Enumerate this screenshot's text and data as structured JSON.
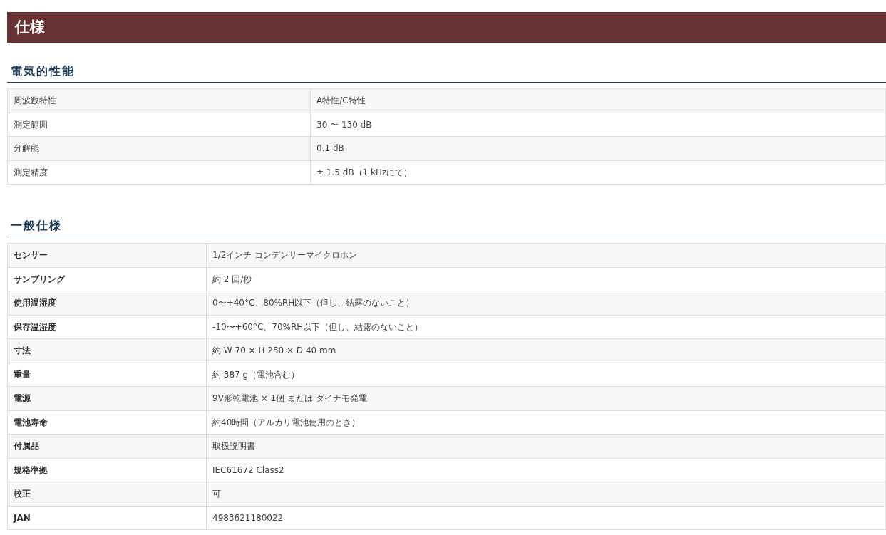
{
  "title": "仕様",
  "sections": [
    {
      "heading": "電気的性能",
      "labels_bold": false,
      "rows": [
        {
          "label": "周波数特性",
          "value": "A特性/C特性"
        },
        {
          "label": "測定範囲",
          "value": "30 〜 130 dB"
        },
        {
          "label": "分解能",
          "value": "0.1 dB"
        },
        {
          "label": "測定精度",
          "value": "± 1.5 dB（1 kHzにて）"
        }
      ]
    },
    {
      "heading": "一般仕様",
      "labels_bold": true,
      "rows": [
        {
          "label": "センサー",
          "value": "1/2インチ コンデンサーマイクロホン"
        },
        {
          "label": "サンプリング",
          "value": "約 2 回/秒"
        },
        {
          "label": "使用温湿度",
          "value": "0〜+40°C、80%RH以下（但し、結露のないこと）"
        },
        {
          "label": "保存温湿度",
          "value": "-10〜+60°C、70%RH以下（但し、結露のないこと）"
        },
        {
          "label": "寸法",
          "value": "約 W 70 × H 250 × D 40 mm"
        },
        {
          "label": "重量",
          "value": "約 387 g（電池含む）"
        },
        {
          "label": "電源",
          "value": "9V形乾電池 × 1個 または ダイナモ発電"
        },
        {
          "label": "電池寿命",
          "value": "約40時間（アルカリ電池使用のとき）"
        },
        {
          "label": "付属品",
          "value": "取扱説明書"
        },
        {
          "label": "規格準拠",
          "value": "IEC61672 Class2"
        },
        {
          "label": "校正",
          "value": "可"
        },
        {
          "label": "JAN",
          "value": "4983621180022"
        }
      ]
    }
  ]
}
